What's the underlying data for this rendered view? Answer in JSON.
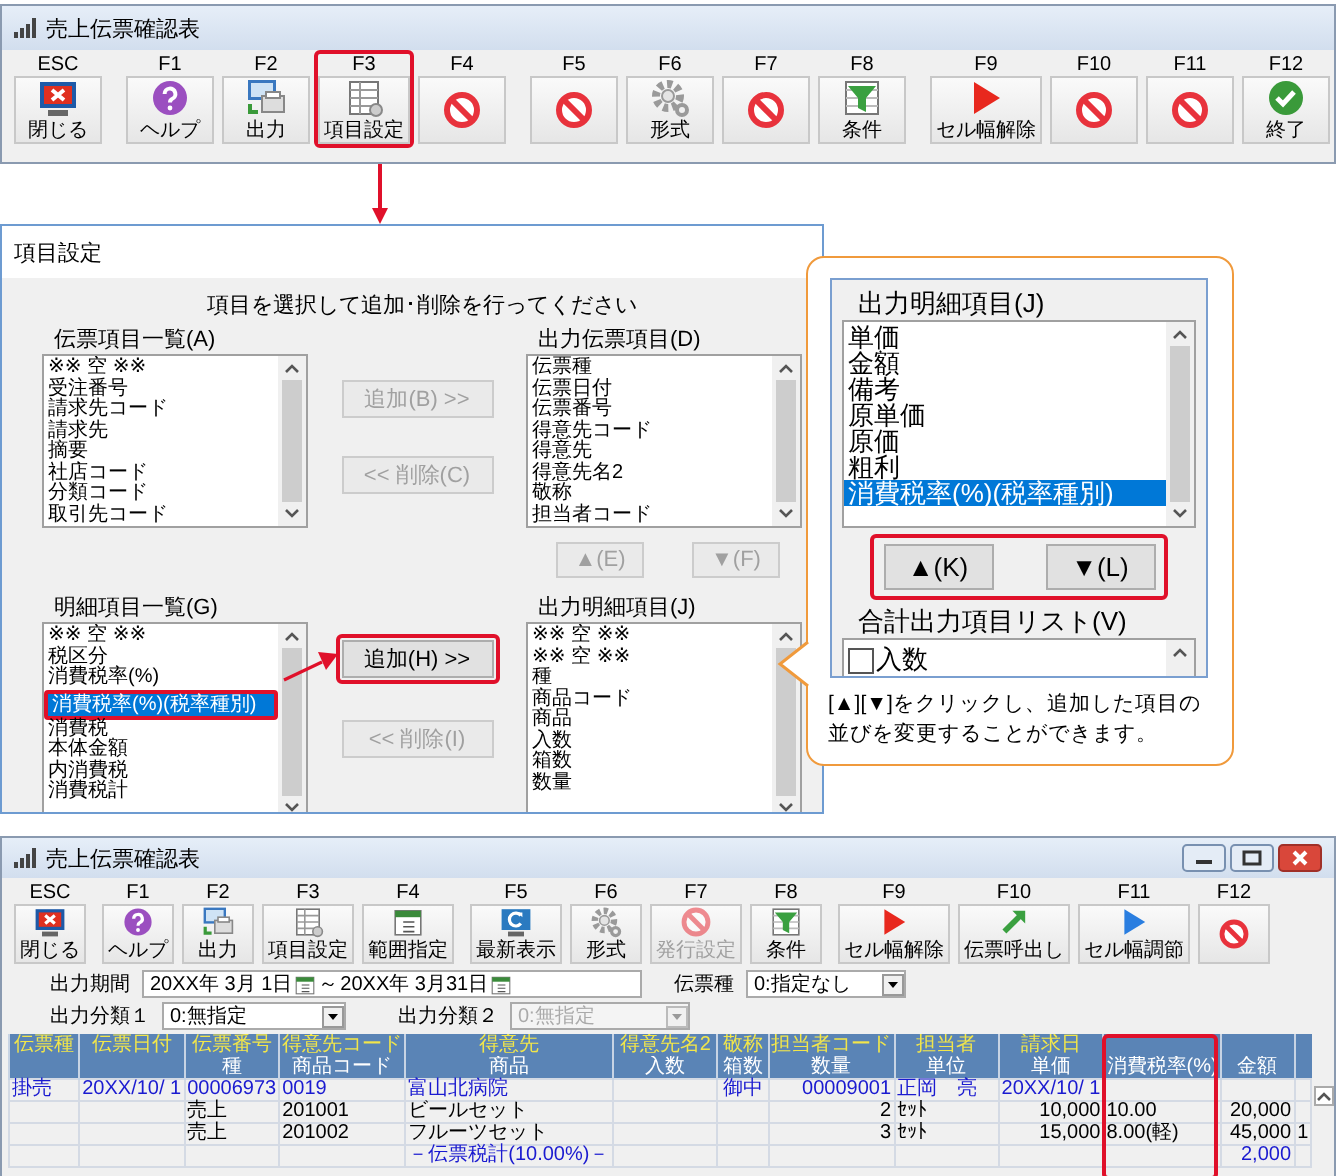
{
  "top_window": {
    "title": "売上伝票確認表",
    "toolbar": [
      [
        {
          "key": "ESC",
          "label": "閉じる",
          "kind": "close",
          "highlighted": false
        }
      ],
      [
        {
          "key": "F1",
          "label": "ヘルプ",
          "kind": "help",
          "highlighted": false
        },
        {
          "key": "F2",
          "label": "出力",
          "kind": "output",
          "highlighted": false
        },
        {
          "key": "F3",
          "label": "項目設定",
          "kind": "columns",
          "highlighted": true
        },
        {
          "key": "F4",
          "kind": "prohibited",
          "highlighted": false
        }
      ],
      [
        {
          "key": "F5",
          "kind": "prohibited",
          "highlighted": false
        },
        {
          "key": "F6",
          "label": "形式",
          "kind": "gear",
          "highlighted": false
        },
        {
          "key": "F7",
          "kind": "prohibited",
          "highlighted": false
        },
        {
          "key": "F8",
          "label": "条件",
          "kind": "filter",
          "highlighted": false
        }
      ],
      [
        {
          "key": "F9",
          "label": "セル幅解除",
          "kind": "play_red",
          "highlighted": false
        },
        {
          "key": "F10",
          "kind": "prohibited",
          "highlighted": false
        },
        {
          "key": "F11",
          "kind": "prohibited",
          "highlighted": false
        },
        {
          "key": "F12",
          "label": "終了",
          "kind": "check",
          "highlighted": false
        }
      ]
    ]
  },
  "dialog": {
    "title": "項目設定",
    "instruction": "項目を選択して追加･削除を行ってください",
    "slip_items": {
      "label": "伝票項目一覧(A)",
      "items": [
        {
          "text": "※※ 空 ※※",
          "selected": false
        },
        {
          "text": "受注番号",
          "selected": false
        },
        {
          "text": "請求先コード",
          "selected": false
        },
        {
          "text": "請求先",
          "selected": false
        },
        {
          "text": "摘要",
          "selected": false
        },
        {
          "text": "社店コード",
          "selected": false
        },
        {
          "text": "分類コード",
          "selected": false
        },
        {
          "text": "取引先コード",
          "selected": false
        }
      ]
    },
    "slip_add_button": {
      "text": "追加(B) >>",
      "disabled": true
    },
    "slip_remove_button": {
      "text": "<< 削除(C)",
      "disabled": true
    },
    "output_slip_items": {
      "label": "出力伝票項目(D)",
      "items": [
        {
          "text": "伝票種",
          "selected": false
        },
        {
          "text": "伝票日付",
          "selected": false
        },
        {
          "text": "伝票番号",
          "selected": false
        },
        {
          "text": "得意先コード",
          "selected": false
        },
        {
          "text": "得意先",
          "selected": false
        },
        {
          "text": "得意先名2",
          "selected": false
        },
        {
          "text": "敬称",
          "selected": false
        },
        {
          "text": "担当者コード",
          "selected": false
        }
      ]
    },
    "move_up_button": {
      "text": "▲(E)",
      "disabled": true
    },
    "move_down_button": {
      "text": "▼(F)",
      "disabled": true
    },
    "detail_items": {
      "label": "明細項目一覧(G)",
      "items": [
        {
          "text": "※※ 空 ※※",
          "selected": false,
          "highlighted": false
        },
        {
          "text": "税区分",
          "selected": false,
          "highlighted": false
        },
        {
          "text": "消費税率(%)",
          "selected": false,
          "highlighted": false
        },
        {
          "text": "消費税率(%)(税率種別)",
          "selected": true,
          "highlighted": true
        },
        {
          "text": "消費税",
          "selected": false,
          "highlighted": false
        },
        {
          "text": "本体金額",
          "selected": false,
          "highlighted": false
        },
        {
          "text": "内消費税",
          "selected": false,
          "highlighted": false
        },
        {
          "text": "消費税計",
          "selected": false,
          "highlighted": false
        }
      ]
    },
    "detail_add_button": {
      "text": "追加(H) >>",
      "disabled": false,
      "highlighted": true
    },
    "detail_remove_button": {
      "text": "<< 削除(I)",
      "disabled": true
    },
    "output_detail_items": {
      "label": "出力明細項目(J)",
      "items": [
        {
          "text": "※※ 空 ※※",
          "selected": false
        },
        {
          "text": "※※ 空 ※※",
          "selected": false
        },
        {
          "text": "種",
          "selected": false
        },
        {
          "text": "商品コード",
          "selected": false
        },
        {
          "text": "商品",
          "selected": false
        },
        {
          "text": "入数",
          "selected": false
        },
        {
          "text": "箱数",
          "selected": false
        },
        {
          "text": "数量",
          "selected": false
        }
      ]
    }
  },
  "callout": {
    "label": "出力明細項目(J)",
    "items": [
      {
        "text": "単価",
        "selected": false
      },
      {
        "text": "金額",
        "selected": false
      },
      {
        "text": "備考",
        "selected": false
      },
      {
        "text": "原単価",
        "selected": false
      },
      {
        "text": "原価",
        "selected": false
      },
      {
        "text": "粗利",
        "selected": false
      },
      {
        "text": "消費税率(%)(税率種別)",
        "selected": true
      }
    ],
    "buttons_highlighted": true,
    "up_button": {
      "text": "▲(K)"
    },
    "down_button": {
      "text": "▼(L)"
    },
    "total_label": "合計出力項目リスト(V)",
    "total_items": [
      {
        "text": "入数",
        "checked": false
      }
    ],
    "note": "[▲][▼]をクリックし、追加した項目の並びを変更することができます。"
  },
  "bottom_window": {
    "title": "売上伝票確認表",
    "toolbar": [
      [
        {
          "key": "ESC",
          "label": "閉じる",
          "kind": "close",
          "disabled": false
        }
      ],
      [
        {
          "key": "F1",
          "label": "ヘルプ",
          "kind": "help",
          "disabled": false
        },
        {
          "key": "F2",
          "label": "出力",
          "kind": "output",
          "disabled": false
        },
        {
          "key": "F3",
          "label": "項目設定",
          "kind": "columns",
          "disabled": false
        },
        {
          "key": "F4",
          "label": "範囲指定",
          "kind": "calendar",
          "disabled": false
        }
      ],
      [
        {
          "key": "F5",
          "label": "最新表示",
          "kind": "refresh",
          "disabled": false
        },
        {
          "key": "F6",
          "label": "形式",
          "kind": "gear",
          "disabled": false
        },
        {
          "key": "F7",
          "label": "発行設定",
          "kind": "prohibited",
          "disabled": true
        },
        {
          "key": "F8",
          "label": "条件",
          "kind": "filter",
          "disabled": false
        }
      ],
      [
        {
          "key": "F9",
          "label": "セル幅解除",
          "kind": "play_red",
          "disabled": false
        },
        {
          "key": "F10",
          "label": "伝票呼出し",
          "kind": "arrow",
          "disabled": false
        },
        {
          "key": "F11",
          "label": "セル幅調節",
          "kind": "play_blue",
          "disabled": false
        },
        {
          "key": "F12",
          "kind": "prohibited",
          "disabled": false
        }
      ]
    ],
    "filters": {
      "period_label": "出力期間",
      "period_from": "20XX年 3月 1日",
      "period_separator": "～",
      "period_to": "20XX年 3月31日",
      "slip_type_label": "伝票種",
      "slip_type_value": "0:指定なし",
      "class1_label": "出力分類１",
      "class1_value": "0:無指定",
      "class2_label": "出力分類２",
      "class2_value": "0:無指定",
      "class2_disabled": true
    },
    "columns": [
      {
        "heading": "伝票種",
        "highlighted": false
      },
      {
        "heading": "伝票日付",
        "highlighted": false
      },
      {
        "heading": "伝票番号",
        "subheading": "種",
        "highlighted": false
      },
      {
        "heading": "得意先コード",
        "subheading": "商品コード",
        "highlighted": false
      },
      {
        "heading": "得意先",
        "subheading": "商品",
        "highlighted": false
      },
      {
        "heading": "得意先名2",
        "subheading": "入数",
        "highlighted": false
      },
      {
        "heading": "敬称",
        "subheading": "箱数",
        "highlighted": false
      },
      {
        "heading": "担当者コード",
        "subheading": "数量",
        "highlighted": false
      },
      {
        "heading": "担当者",
        "subheading": "単位",
        "highlighted": false
      },
      {
        "heading": "請求日",
        "subheading": "単価",
        "highlighted": false
      },
      {
        "subheading": "消費税率(%)",
        "highlighted": true
      },
      {
        "subheading": "金額",
        "highlighted": false
      },
      {
        "highlighted": false
      }
    ],
    "rows": [
      {
        "kind": "slip",
        "cells": [
          "掛売",
          "20XX/10/ 1",
          "00006973",
          "0019",
          "富山北病院",
          null,
          "御中",
          "00009001",
          "正岡　亮",
          "20XX/10/ 1",
          null,
          null,
          null
        ]
      },
      {
        "kind": "detail",
        "cells": [
          null,
          null,
          "売上",
          "201001",
          "ビールセット",
          null,
          null,
          "2",
          "ｾｯﾄ",
          "10,000",
          "10.00",
          "20,000",
          null
        ]
      },
      {
        "kind": "detail",
        "cells": [
          null,
          null,
          "売上",
          "201002",
          "フルーツセット",
          null,
          null,
          "3",
          "ｾｯﾄ",
          "15,000",
          "8.00(軽)",
          "45,000",
          "1"
        ]
      },
      {
        "kind": "subtotal",
        "cells": [
          null,
          null,
          null,
          null,
          "－伝票税計(10.00%)－",
          null,
          null,
          null,
          null,
          null,
          null,
          "2,000",
          null
        ]
      }
    ]
  }
}
